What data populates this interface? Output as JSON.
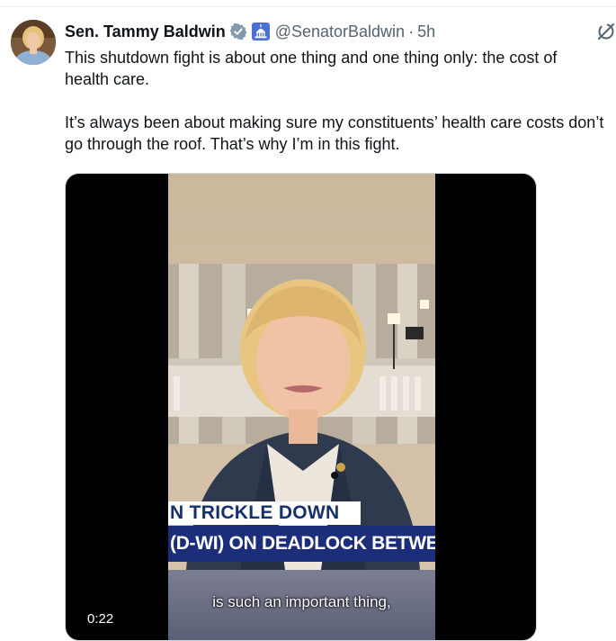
{
  "tweet": {
    "author_name": "Sen. Tammy Baldwin",
    "handle": "@SenatorBaldwin",
    "separator": "·",
    "time": "5h",
    "text_p1": "This shutdown fight is about one thing and one thing only: the cost of health care.",
    "text_p2": "It’s always been about making sure my constituents’ health care costs don’t go through the roof. That’s why I’m in this fight."
  },
  "video": {
    "chyron_top": "N TRICKLE DOWN",
    "chyron_bottom": "(D-WI) ON DEADLOCK BETWEEN PA",
    "subtitle": "is such an important thing,",
    "duration": "0:22"
  },
  "icons": {
    "verified": "verified-badge-icon",
    "government": "capitol-building-icon",
    "grok": "grok-icon"
  },
  "colors": {
    "verified_badge": "#829aab",
    "gov_badge_bg": "#4a6fd6",
    "chyron_navy": "#1c2e7a",
    "secondary_text": "#536471"
  }
}
